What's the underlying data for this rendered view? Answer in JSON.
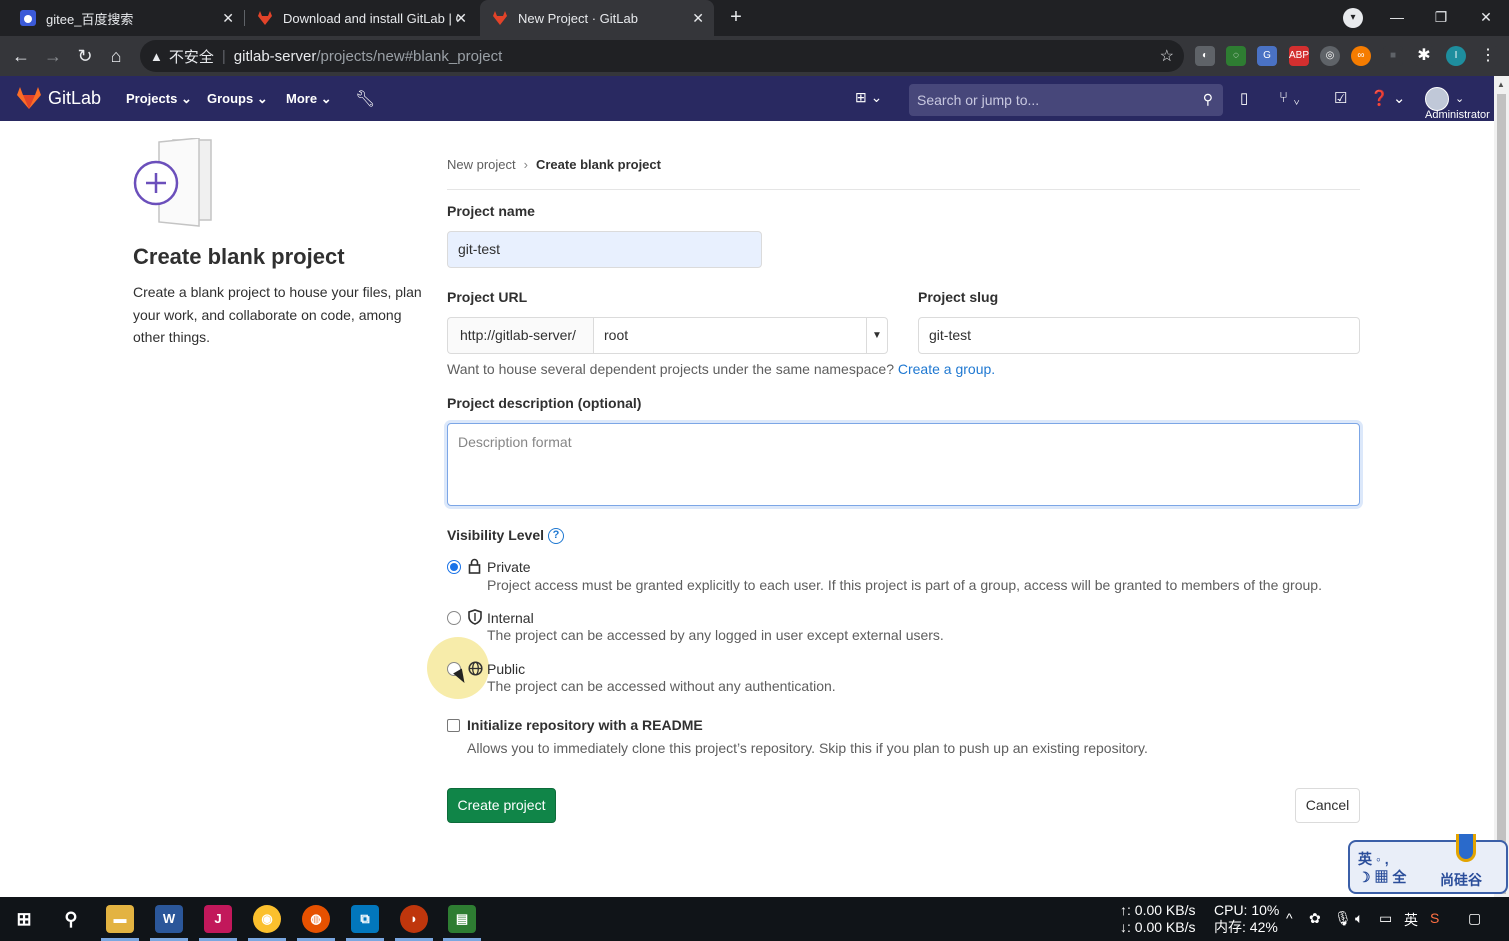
{
  "browser": {
    "tabs": [
      {
        "title": "gitee_百度搜索"
      },
      {
        "title": "Download and install GitLab | G"
      },
      {
        "title": "New Project · GitLab"
      }
    ],
    "address": {
      "security": "不安全",
      "host": "gitlab-server",
      "path": "/projects/new#blank_project"
    }
  },
  "gitlab_nav": {
    "brand": "GitLab",
    "menus": [
      "Projects",
      "Groups",
      "More"
    ],
    "search_placeholder": "Search or jump to...",
    "user_label": "Administrator"
  },
  "sidebar": {
    "title": "Create blank project",
    "description": "Create a blank project to house your files, plan your work, and collaborate on code, among other things."
  },
  "breadcrumb": {
    "parent": "New project",
    "current": "Create blank project"
  },
  "form": {
    "project_name_label": "Project name",
    "project_name_value": "git-test",
    "project_url_label": "Project URL",
    "url_prefix": "http://gitlab-server/",
    "namespace_value": "root",
    "project_slug_label": "Project slug",
    "project_slug_value": "git-test",
    "namespace_hint": "Want to house several dependent projects under the same namespace?",
    "namespace_hint_link": "Create a group.",
    "description_label": "Project description (optional)",
    "description_placeholder": "Description format",
    "visibility_label": "Visibility Level",
    "visibility_help": "?",
    "visibility": [
      {
        "name": "Private",
        "desc": "Project access must be granted explicitly to each user. If this project is part of a group, access will be granted to members of the group.",
        "checked": true
      },
      {
        "name": "Internal",
        "desc": "The project can be accessed by any logged in user except external users.",
        "checked": false
      },
      {
        "name": "Public",
        "desc": "The project can be accessed without any authentication.",
        "checked": false
      }
    ],
    "readme_label": "Initialize repository with a README",
    "readme_desc": "Allows you to immediately clone this project’s repository. Skip this if you plan to push up an existing repository.",
    "create_button": "Create project",
    "cancel_button": "Cancel"
  },
  "ime_widget": {
    "left_top": "英 ◦ ,",
    "left_bottom": "☽ ▦ 全",
    "right_label": "尚硅谷"
  },
  "taskbar": {
    "net_up": "↑: 0.00 KB/s",
    "net_down": "↓: 0.00 KB/s",
    "cpu": "CPU: 10%",
    "mem": "内存: 42%",
    "lang": "英",
    "apps": [
      "W",
      "J"
    ]
  },
  "colors": {
    "gitlab_header": "#292961",
    "primary_button": "#108548",
    "link": "#1f78d1"
  }
}
